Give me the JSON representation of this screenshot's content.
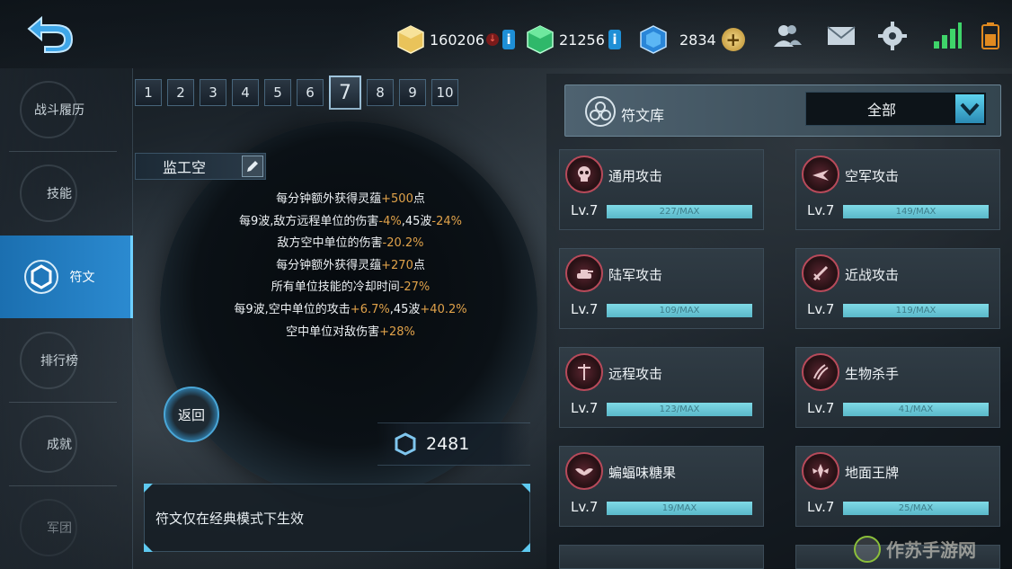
{
  "topbar": {
    "gold": "160206",
    "green_gems": "21256",
    "blue_gems": "2834",
    "info_label": "i",
    "plus_label": "+",
    "down_label": "↓"
  },
  "sidebar": {
    "items": [
      {
        "label": "战斗履历"
      },
      {
        "label": "技能"
      },
      {
        "label": "符文"
      },
      {
        "label": "排行榜"
      },
      {
        "label": "成就"
      },
      {
        "label": "军团"
      }
    ]
  },
  "pages": [
    "1",
    "2",
    "3",
    "4",
    "5",
    "6",
    "7",
    "8",
    "9",
    "10"
  ],
  "active_page": "7",
  "loadout": {
    "name": "监工空",
    "effects": [
      {
        "text": "每分钟额外获得灵蕴",
        "value": "+500",
        "suffix": "点"
      },
      {
        "text": "每9波,敌方远程单位的伤害",
        "value": "-4%",
        "mid": ",45波",
        "value2": "-24%"
      },
      {
        "text": "敌方空中单位的伤害",
        "value": "-20.2%"
      },
      {
        "text": "每分钟额外获得灵蕴",
        "value": "+270",
        "suffix": "点"
      },
      {
        "text": "所有单位技能的冷却时间",
        "value": "-27%"
      },
      {
        "text": "每9波,空中单位的攻击",
        "value": "+6.7%",
        "mid": ",45波",
        "value2": "+40.2%"
      },
      {
        "text": "空中单位对敌伤害",
        "value": "+28%"
      }
    ],
    "return_label": "返回",
    "points": "2481",
    "notice": "符文仅在经典模式下生效"
  },
  "library": {
    "title": "符文库",
    "filter": "全部",
    "runes": [
      {
        "name": "通用攻击",
        "level": "Lv.7",
        "progress": "227/MAX"
      },
      {
        "name": "空军攻击",
        "level": "Lv.7",
        "progress": "149/MAX"
      },
      {
        "name": "陆军攻击",
        "level": "Lv.7",
        "progress": "109/MAX"
      },
      {
        "name": "近战攻击",
        "level": "Lv.7",
        "progress": "119/MAX"
      },
      {
        "name": "远程攻击",
        "level": "Lv.7",
        "progress": "123/MAX"
      },
      {
        "name": "生物杀手",
        "level": "Lv.7",
        "progress": "41/MAX"
      },
      {
        "name": "蝙蝠味糖果",
        "level": "Lv.7",
        "progress": "19/MAX"
      },
      {
        "name": "地面王牌",
        "level": "Lv.7",
        "progress": "25/MAX"
      }
    ]
  },
  "watermark": "作苏手游网",
  "colors": {
    "accent_blue": "#2b8ad0",
    "highlight_orange": "#e0a24a",
    "bar_cyan": "#7fd9e6",
    "rune_red": "#b84a5a"
  }
}
